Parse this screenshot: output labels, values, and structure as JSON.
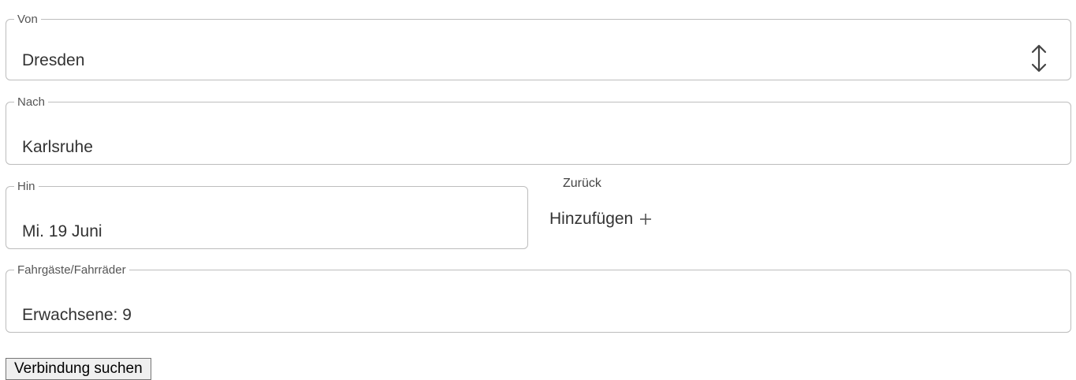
{
  "from": {
    "label": "Von",
    "value": "Dresden",
    "swap_icon": "swap-vertical-icon"
  },
  "to": {
    "label": "Nach",
    "value": "Karlsruhe"
  },
  "outbound": {
    "label": "Hin",
    "value": "Mi. 19 Juni"
  },
  "return": {
    "label": "Zurück",
    "add_label": "Hinzufügen",
    "add_icon": "plus-icon"
  },
  "passengers": {
    "label": "Fahrgäste/Fahrräder",
    "value": "Erwachsene: 9"
  },
  "submit": {
    "label": "Verbindung suchen"
  },
  "colors": {
    "border": "#bdbdbd",
    "text": "#333333",
    "label": "#555555"
  }
}
